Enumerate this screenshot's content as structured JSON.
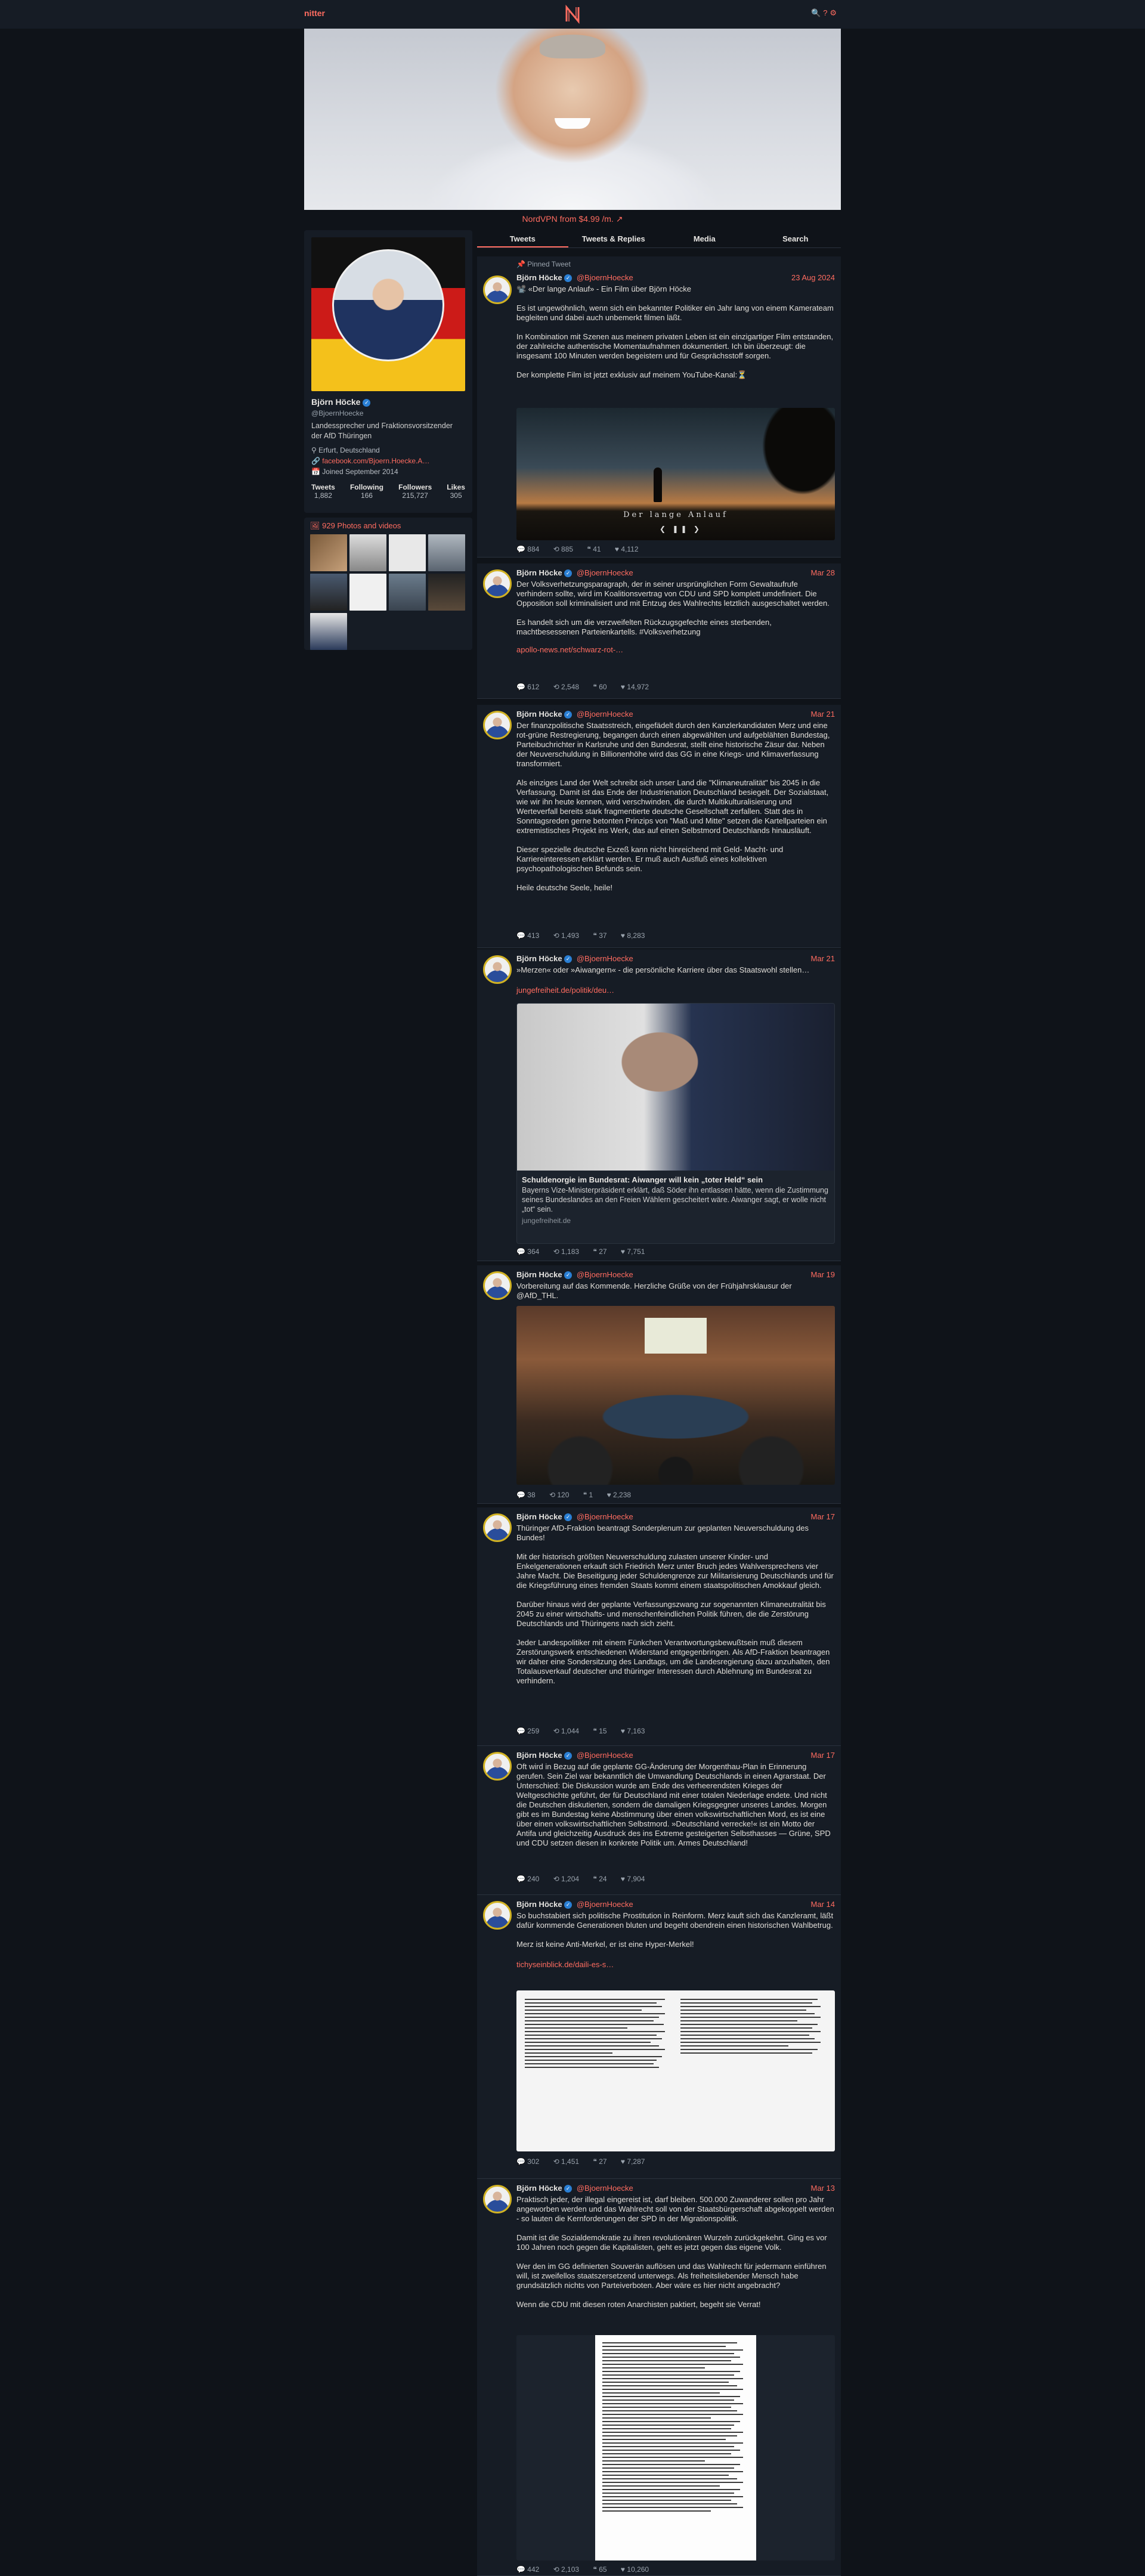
{
  "nav": {
    "brand": "nitter",
    "logo_letter": "N",
    "icons": [
      "search-icon",
      "help-icon",
      "settings-icon"
    ]
  },
  "promo": {
    "text": "NordVPN from $4.99 /m. ↗"
  },
  "profile": {
    "name": "Björn Höcke",
    "handle": "@BjoernHoecke",
    "bio": "Landessprecher und Fraktionsvorsitzender der AfD Thüringen",
    "location": "Erfurt, Deutschland",
    "website": "facebook.com/Bjoern.Hoecke.A…",
    "joined": "Joined September 2014",
    "stats": [
      {
        "label": "Tweets",
        "value": "1,882"
      },
      {
        "label": "Following",
        "value": "166"
      },
      {
        "label": "Followers",
        "value": "215,727"
      },
      {
        "label": "Likes",
        "value": "305"
      }
    ],
    "photos_label": "929 Photos and videos"
  },
  "tabs": [
    {
      "label": "Tweets",
      "active": true
    },
    {
      "label": "Tweets & Replies",
      "active": false
    },
    {
      "label": "Media",
      "active": false
    },
    {
      "label": "Search",
      "active": false
    }
  ],
  "tweets": [
    {
      "pinned": "Pinned Tweet",
      "name": "Björn Höcke",
      "handle": "@BjoernHoecke",
      "date": "23 Aug 2024",
      "paragraphs": [
        "📽️ «Der lange Anlauf» - Ein Film über Björn Höcke",
        "Es ist ungewöhnlich, wenn sich ein bekannter Politiker ein Jahr lang von einem Kamerateam begleiten und dabei auch unbemerkt filmen läßt.",
        "In Kombination mit Szenen aus meinem privaten Leben ist ein einzigartiger Film entstanden, der zahlreiche authentische Momentaufnahmen dokumentiert. Ich bin überzeugt: die insgesamt 100 Minuten werden begeistern und für Gesprächsstoff sorgen.",
        "Der komplette Film ist jetzt exklusiv auf meinem YouTube-Kanal:⏳"
      ],
      "media_caption": "Der lange Anlauf",
      "stats": [
        "884",
        "885",
        "41",
        "4,112"
      ]
    },
    {
      "name": "Björn Höcke",
      "handle": "@BjoernHoecke",
      "date": "Mar 28",
      "paragraphs": [
        "Der Volksverhetzungsparagraph, der in seiner ursprünglichen Form Gewaltaufrufe verhindern sollte, wird im Koalitionsvertrag von CDU und SPD komplett umdefiniert. Die Opposition soll kriminalisiert und mit Entzug des Wahlrechts letztlich ausgeschaltet werden.",
        " Es handelt sich um die verzweifelten Rückzugsgefechte eines sterbenden, machtbesessenen Parteienkartells. #Volksverhetzung"
      ],
      "link": "apollo-news.net/schwarz-rot-…",
      "stats": [
        "612",
        "2,548",
        "60",
        "14,972"
      ]
    },
    {
      "name": "Björn Höcke",
      "handle": "@BjoernHoecke",
      "date": "Mar 21",
      "paragraphs": [
        "Der finanzpolitische Staatsstreich, eingefädelt durch den Kanzlerkandidaten Merz und eine rot-grüne Restregierung, begangen durch einen abgewählten und aufgeblähten Bundestag, Parteibuchrichter in Karlsruhe und den Bundesrat, stellt eine historische Zäsur dar. Neben der Neuverschuldung in Billionenhöhe wird das GG in eine Kriegs- und Klimaverfassung transformiert.",
        "Als einziges Land der Welt schreibt sich unser Land die \"Klimaneutralität\" bis 2045 in die Verfassung. Damit ist das Ende der Industrienation Deutschland besiegelt. Der Sozialstaat, wie wir ihn heute kennen, wird verschwinden, die durch Multikulturalisierung und Werteverfall bereits stark fragmentierte deutsche Gesellschaft zerfallen. Statt des in Sonntagsreden gerne betonten Prinzips von \"Maß und Mitte\" setzen die Kartellparteien ein extremistisches Projekt ins Werk, das auf einen Selbstmord Deutschlands hinausläuft.",
        "Dieser spezielle deutsche Exzeß kann nicht hinreichend mit Geld- Macht- und Karriereinteressen erklärt werden. Er muß auch Ausfluß eines kollektiven psychopathologischen Befunds sein.",
        "Heile deutsche Seele, heile!"
      ],
      "stats": [
        "413",
        "1,493",
        "37",
        "8,283"
      ]
    },
    {
      "name": "Björn Höcke",
      "handle": "@BjoernHoecke",
      "date": "Mar 21",
      "paragraphs": [
        "»Merzen« oder »Aiwangern« - die persönliche Karriere über das Staatswohl stellen…"
      ],
      "link": "jungefreiheit.de/politik/deu…",
      "card": {
        "title": "Schuldenorgie im Bundesrat: Aiwanger will kein „toter Held“ sein",
        "desc": "Bayerns Vize-Ministerpräsident erklärt, daß Söder ihn entlassen hätte, wenn die Zustimmung seines Bundeslandes an den Freien Wählern gescheitert wäre. Aiwanger sagt, er wolle nicht „tot“ sein.",
        "url": "jungefreiheit.de"
      },
      "stats": [
        "364",
        "1,183",
        "27",
        "7,751"
      ]
    },
    {
      "name": "Björn Höcke",
      "handle": "@BjoernHoecke",
      "date": "Mar 19",
      "paragraphs": [
        "Vorbereitung auf das Kommende. Herzliche Grüße von der Frühjahrsklausur der @AfD_THL."
      ],
      "stats": [
        "38",
        "120",
        "1",
        "2,238"
      ]
    },
    {
      "name": "Björn Höcke",
      "handle": "@BjoernHoecke",
      "date": "Mar 17",
      "paragraphs": [
        "Thüringer AfD-Fraktion beantragt Sonderplenum zur geplanten Neuverschuldung des Bundes!",
        "Mit der historisch größten Neuverschuldung zulasten unserer Kinder- und Enkelgenerationen erkauft sich Friedrich Merz unter Bruch jedes Wahlversprechens vier Jahre Macht. Die Beseitigung jeder Schuldengrenze zur Militarisierung Deutschlands und für die Kriegsführung eines fremden Staats kommt einem staatspolitischen Amokkauf gleich.",
        "Darüber hinaus wird der geplante Verfassungszwang zur sogenannten Klimaneutralität bis 2045 zu einer wirtschafts- und menschenfeindlichen Politik führen, die die Zerstörung Deutschlands und Thüringens nach sich zieht.",
        "Jeder Landespolitiker mit einem Fünkchen Verantwortungsbewußtsein muß diesem Zerstörungswerk entschiedenen Widerstand entgegenbringen. Als AfD-Fraktion beantragen wir daher eine Sondersitzung des Landtags, um die Landesregierung dazu anzuhalten, den Totalausverkauf deutscher und thüringer Interessen durch Ablehnung im Bundesrat zu verhindern."
      ],
      "stats": [
        "259",
        "1,044",
        "15",
        "7,163"
      ]
    },
    {
      "name": "Björn Höcke",
      "handle": "@BjoernHoecke",
      "date": "Mar 17",
      "paragraphs": [
        "Oft wird in Bezug auf die geplante GG-Änderung der Morgenthau-Plan in Erinnerung gerufen. Sein Ziel war bekanntlich die Umwandlung Deutschlands in einen Agrarstaat. Der Unterschied: Die Diskussion wurde am Ende des verheerendsten Krieges der Weltgeschichte geführt, der für Deutschland mit einer totalen Niederlage endete. Und nicht die Deutschen diskutierten, sondern die damaligen Kriegsgegner unseres Landes. Morgen gibt es im Bundestag keine Abstimmung über einen volkswirtschaftlichen Mord, es ist eine über einen volkswirtschaftlichen Selbstmord. »Deutschland verrecke!« ist ein Motto der Antifa und gleichzeitig Ausdruck des ins Extreme gesteigerten Selbsthasses — Grüne, SPD und CDU setzen diesen in konkrete Politik um. Armes Deutschland!"
      ],
      "stats": [
        "240",
        "1,204",
        "24",
        "7,904"
      ]
    },
    {
      "name": "Björn Höcke",
      "handle": "@BjoernHoecke",
      "date": "Mar 14",
      "paragraphs": [
        "So buchstabiert sich politische Prostitution in Reinform. Merz kauft sich das Kanzleramt, läßt dafür kommende Generationen bluten und begeht obendrein einen historischen Wahlbetrug.",
        "Merz ist keine Anti-Merkel, er ist eine Hyper-Merkel!"
      ],
      "link": "tichyseinblick.de/daili-es-s…",
      "stats": [
        "302",
        "1,451",
        "27",
        "7,287"
      ]
    },
    {
      "name": "Björn Höcke",
      "handle": "@BjoernHoecke",
      "date": "Mar 13",
      "paragraphs": [
        "Praktisch jeder, der illegal eingereist ist, darf bleiben. 500.000 Zuwanderer sollen pro Jahr angeworben werden und das Wahlrecht soll von der Staatsbürgerschaft abgekoppelt werden - so lauten die Kernforderungen der SPD in der Migrationspolitik.",
        "Damit ist die Sozialdemokratie zu ihren revolutionären Wurzeln zurückgekehrt. Ging es vor 100 Jahren noch gegen die Kapitalisten, geht es jetzt gegen das eigene Volk.",
        "Wer den im GG definierten Souverän auflösen und das Wahlrecht für jedermann einführen will, ist zweifellos staatszersetzend unterwegs. Als freiheitsliebender Mensch  habe grundsätzlich nichts von Parteiverboten. Aber wäre es hier nicht angebracht?",
        "Wenn die CDU mit diesen roten Anarchisten paktiert, begeht sie Verrat!"
      ],
      "stats": [
        "442",
        "2,103",
        "65",
        "10,260"
      ]
    }
  ],
  "colors": {
    "accent": "#ff6c60",
    "background": "#0f1319",
    "card": "#161c25"
  }
}
